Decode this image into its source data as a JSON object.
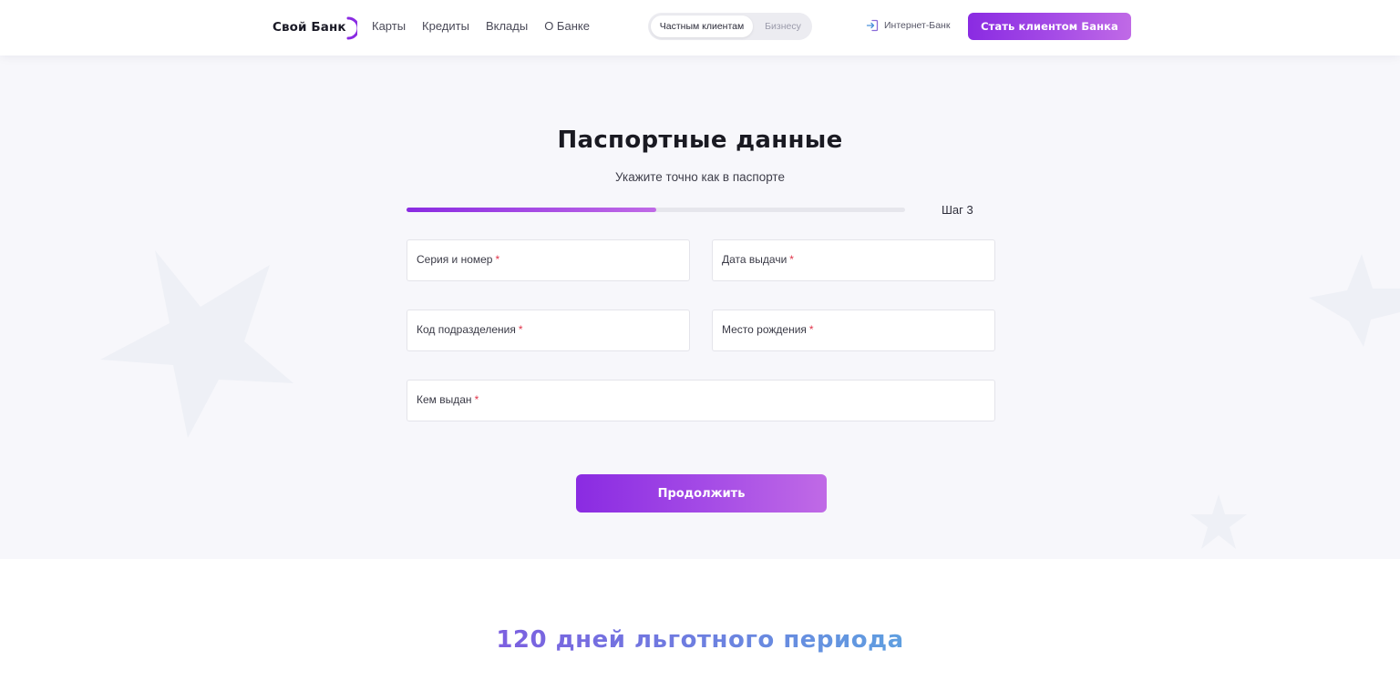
{
  "header": {
    "logo_text": "Свой Банк",
    "nav": [
      "Карты",
      "Кредиты",
      "Вклады",
      "О Банке"
    ],
    "segment": {
      "active": "Частным клиентам",
      "inactive": "Бизнесу"
    },
    "internet_bank": {
      "icon": "login-icon",
      "label": "Интернет-Банк"
    },
    "cta": "Стать клиентом Банка"
  },
  "form": {
    "title": "Паспортные данные",
    "subtitle": "Укажите точно как в паспорте",
    "progress_fraction": 0.5,
    "step": "Шаг 3",
    "fields": {
      "series_number": "Серия и номер",
      "issue_date": "Дата выдачи",
      "division_code": "Код подразделения",
      "birth_place": "Место рождения",
      "issued_by": "Кем выдан"
    },
    "required_mark": "*",
    "submit": "Продолжить"
  },
  "promo": {
    "title": "120 дней льготного периода"
  },
  "colors": {
    "accent_start": "#8a2be2",
    "accent_end": "#c06ae6",
    "required": "#e0344a",
    "section_bg": "#f7f7fb"
  }
}
